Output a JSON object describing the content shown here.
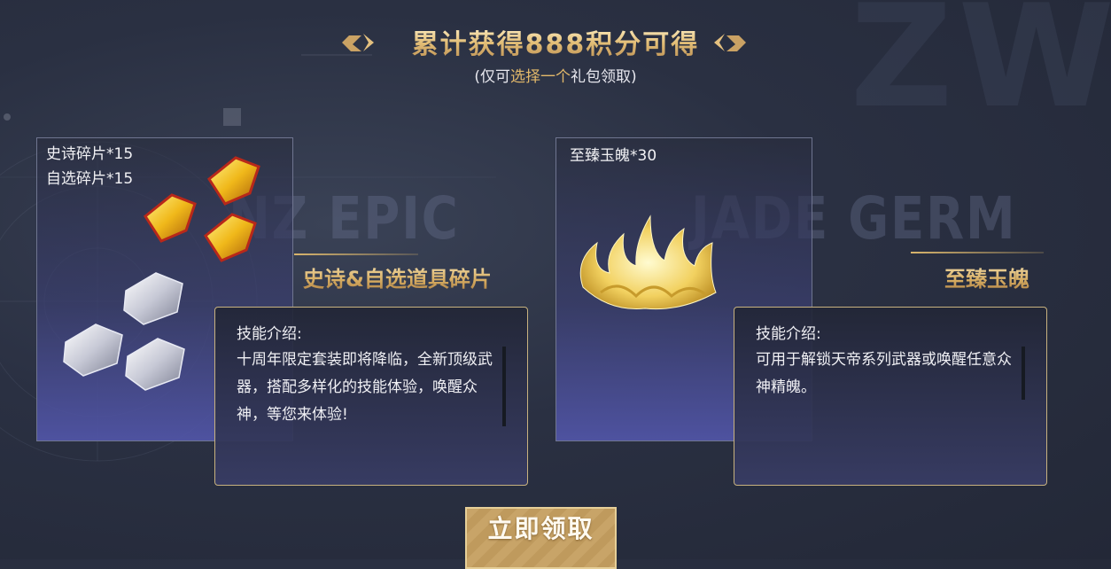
{
  "header": {
    "title": "累计获得888积分可得",
    "subtitle_prefix": "(仅可",
    "subtitle_highlight": "选择一个",
    "subtitle_suffix": "礼包领取)"
  },
  "packages": [
    {
      "labels": [
        "史诗碎片*15",
        "自选碎片*15"
      ],
      "watermark": "NZ EPIC",
      "name": "史诗&自选道具碎片",
      "desc_title": "技能介绍:",
      "desc_text": "十周年限定套装即将降临，全新顶级武器，搭配多样化的技能体验，唤醒众神，等您来体验!"
    },
    {
      "labels": [
        "至臻玉魄*30"
      ],
      "watermark": "JADE GERM",
      "name": "至臻玉魄",
      "desc_title": "技能介绍:",
      "desc_text": "可用于解锁天帝系列武器或唤醒任意众神精魄。"
    }
  ],
  "claim_button": {
    "label": "立即领取"
  },
  "icons": [
    "gold-fragment-icon",
    "silver-fragment-icon",
    "jade-flame-icon"
  ],
  "colors": {
    "gold": "#d7ad62",
    "panel_border": "#c8b27f",
    "card_bottom": "#5256aa"
  }
}
